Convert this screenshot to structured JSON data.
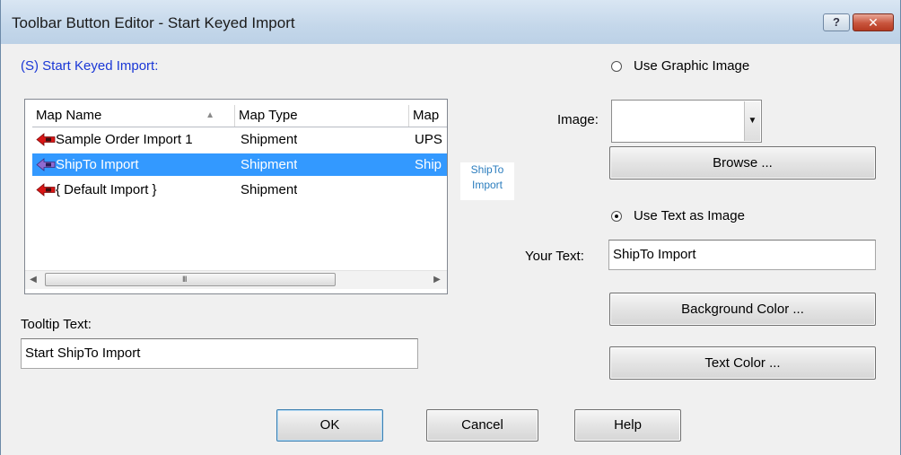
{
  "window": {
    "title": "Toolbar Button Editor - Start Keyed Import",
    "help_glyph": "?",
    "close_glyph": "✕"
  },
  "heading": "(S) Start Keyed Import:",
  "list": {
    "columns": [
      "Map Name",
      "Map Type",
      "Map"
    ],
    "rows": [
      {
        "name": "Sample Order Import 1",
        "type": "Shipment",
        "map": "UPS",
        "selected": false
      },
      {
        "name": "ShipTo Import",
        "type": "Shipment",
        "map": "Ship",
        "selected": true
      },
      {
        "name": "{ Default Import }",
        "type": "Shipment",
        "map": "",
        "selected": false
      }
    ],
    "icon": "red-arrow-map-icon"
  },
  "preview": {
    "line1": "ShipTo",
    "line2": "Import"
  },
  "tooltip": {
    "label": "Tooltip Text:",
    "value": "Start ShipTo Import"
  },
  "graphic_option": {
    "label": "Use Graphic Image",
    "checked": false
  },
  "image": {
    "label": "Image:",
    "value": ""
  },
  "browse_label": "Browse ...",
  "text_option": {
    "label": "Use Text as Image",
    "checked": true
  },
  "your_text": {
    "label": "Your Text:",
    "value": "ShipTo Import"
  },
  "background_color_label": "Background Color ...",
  "text_color_label": "Text Color ...",
  "buttons": {
    "ok": "OK",
    "cancel": "Cancel",
    "help": "Help"
  },
  "colors": {
    "heading": "#1a37d6",
    "selection": "#3399ff",
    "preview_text": "#2b7dbe"
  }
}
